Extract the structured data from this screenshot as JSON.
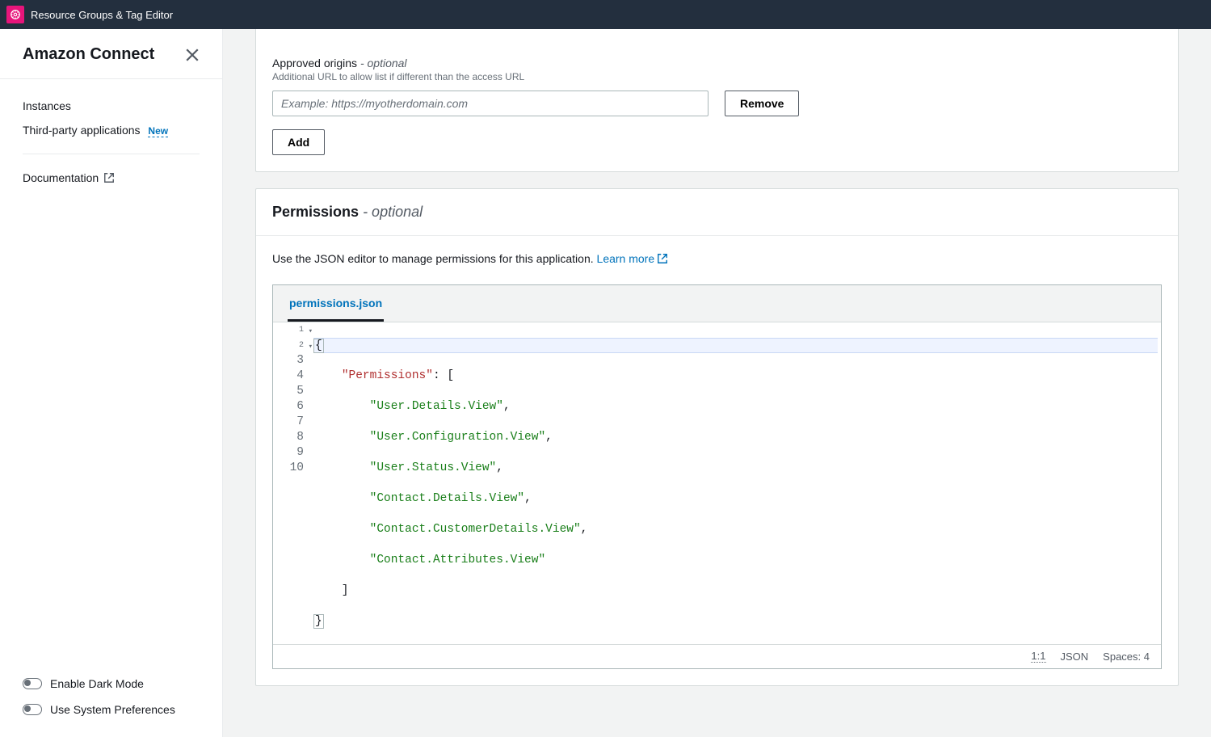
{
  "topbar": {
    "service_name": "Resource Groups & Tag Editor"
  },
  "sidebar": {
    "title": "Amazon Connect",
    "items": {
      "instances": "Instances",
      "third_party": "Third-party applications",
      "new_badge": "New",
      "documentation": "Documentation"
    },
    "footer": {
      "dark_mode": "Enable Dark Mode",
      "system_prefs": "Use System Preferences"
    }
  },
  "origins": {
    "title": "Approved origins",
    "optional": " - optional",
    "desc": "Additional URL to allow list if different than the access URL",
    "placeholder": "Example: https://myotherdomain.com",
    "remove": "Remove",
    "add": "Add"
  },
  "permissions": {
    "title": "Permissions",
    "optional": " - optional",
    "desc_prefix": "Use the JSON editor to manage permissions for this application. ",
    "learn_more": "Learn more",
    "tab": "permissions.json",
    "code": {
      "l1": "{",
      "l2_key": "\"Permissions\"",
      "l2_rest": ": [",
      "l3": "\"User.Details.View\"",
      "l4": "\"User.Configuration.View\"",
      "l5": "\"User.Status.View\"",
      "l6": "\"Contact.Details.View\"",
      "l7": "\"Contact.CustomerDetails.View\"",
      "l8": "\"Contact.Attributes.View\"",
      "l9": "    ]",
      "l10": "}"
    },
    "status": {
      "pos": "1:1",
      "lang": "JSON",
      "spaces": "Spaces: 4"
    }
  }
}
